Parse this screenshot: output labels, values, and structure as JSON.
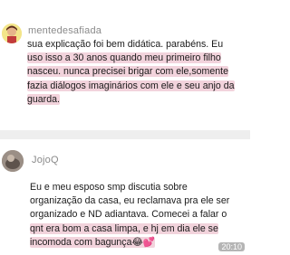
{
  "comments": [
    {
      "username": "mentedesafiada",
      "lines": [
        "sua explicação foi bem didática. parabéns. Eu",
        "uso isso a 30 anos quando meu primeiro filho",
        "nasceu. nunca precisei brigar com ele,somente",
        "fazia diálogos imaginários com ele e seu anjo da",
        "guarda."
      ]
    },
    {
      "username": "JojoQ",
      "lines": [
        "Eu e meu esposo smp discutia sobre",
        "organização da casa, eu reclamava pra ele ser",
        "organizado e ND adiantava. Comecei a falar o",
        "qnt era bom a casa limpa, e hj em dia ele se",
        "incomoda com bagunça😂💕"
      ],
      "time": "20:10"
    }
  ]
}
